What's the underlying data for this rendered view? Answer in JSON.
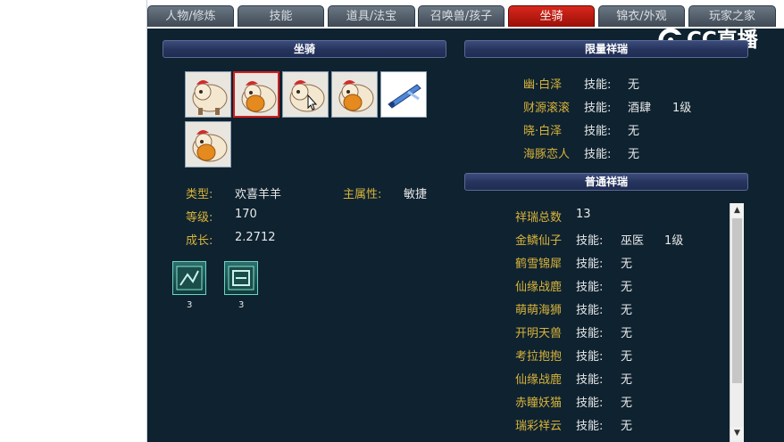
{
  "tabs": [
    {
      "label": "人物/修炼"
    },
    {
      "label": "技能"
    },
    {
      "label": "道具/法宝"
    },
    {
      "label": "召唤兽/孩子"
    },
    {
      "label": "坐骑"
    },
    {
      "label": "锦衣/外观"
    },
    {
      "label": "玩家之家"
    }
  ],
  "active_tab_index": 4,
  "watermark": "CC直播",
  "mount_section": {
    "title": "坐骑",
    "slots": [
      {
        "icon": "sheep-mount-icon",
        "selected": false
      },
      {
        "icon": "sheep-mount-orange-icon",
        "selected": true
      },
      {
        "icon": "sheep-mount-icon",
        "selected": false
      },
      {
        "icon": "sheep-mount-orange-icon",
        "selected": false
      },
      {
        "icon": "blue-sword-mount-icon",
        "selected": false
      },
      {
        "icon": "sheep-mount-orange-icon",
        "selected": false
      }
    ],
    "type_label": "类型:",
    "type_value": "欢喜羊羊",
    "main_attr_label": "主属性:",
    "main_attr_value": "敏捷",
    "level_label": "等级:",
    "level_value": "170",
    "growth_label": "成长:",
    "growth_value": "2.2712",
    "skills": [
      {
        "icon": "skill-scroll-icon",
        "count": "3"
      },
      {
        "icon": "skill-book-icon",
        "count": "3"
      }
    ]
  },
  "limited_section": {
    "title": "限量祥瑞",
    "items": [
      {
        "name": "幽·白泽",
        "skill_label": "技能:",
        "skill": "无",
        "level": ""
      },
      {
        "name": "财源滚滚",
        "skill_label": "技能:",
        "skill": "酒肆",
        "level": "1级"
      },
      {
        "name": "晓·白泽",
        "skill_label": "技能:",
        "skill": "无",
        "level": ""
      },
      {
        "name": "海豚恋人",
        "skill_label": "技能:",
        "skill": "无",
        "level": ""
      }
    ]
  },
  "common_section": {
    "title": "普通祥瑞",
    "total_label": "祥瑞总数",
    "total_value": "13",
    "items": [
      {
        "name": "金鳞仙子",
        "skill_label": "技能:",
        "skill": "巫医",
        "level": "1级"
      },
      {
        "name": "鹤雪锦犀",
        "skill_label": "技能:",
        "skill": "无",
        "level": ""
      },
      {
        "name": "仙缘战鹿",
        "skill_label": "技能:",
        "skill": "无",
        "level": ""
      },
      {
        "name": "萌萌海狮",
        "skill_label": "技能:",
        "skill": "无",
        "level": ""
      },
      {
        "name": "开明天兽",
        "skill_label": "技能:",
        "skill": "无",
        "level": ""
      },
      {
        "name": "考拉抱抱",
        "skill_label": "技能:",
        "skill": "无",
        "level": ""
      },
      {
        "name": "仙缘战鹿",
        "skill_label": "技能:",
        "skill": "无",
        "level": ""
      },
      {
        "name": "赤瞳妖猫",
        "skill_label": "技能:",
        "skill": "无",
        "level": ""
      },
      {
        "name": "瑞彩祥云",
        "skill_label": "技能:",
        "skill": "无",
        "level": ""
      }
    ]
  },
  "colors": {
    "panel_bg": "#0e2230",
    "gold": "#d8b33a",
    "text": "#e8e8e8",
    "active_tab": "#c41f14"
  }
}
